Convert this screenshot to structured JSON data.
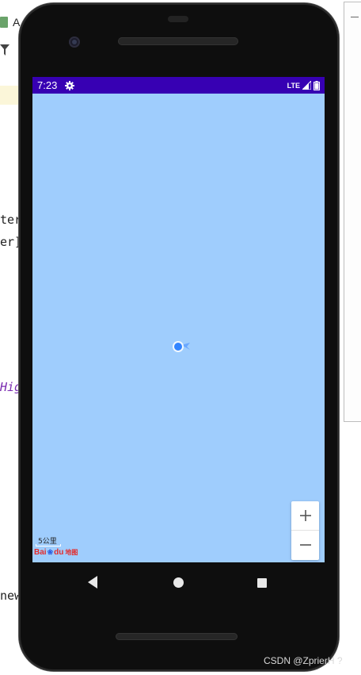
{
  "ide": {
    "tab_label": "A",
    "code_fragments": [
      "ter",
      "er]",
      "Hig",
      "new"
    ]
  },
  "status_bar": {
    "time": "7:23",
    "network": "LTE"
  },
  "map": {
    "scale_label": "5公里",
    "logo": {
      "bai": "Bai",
      "du": "du",
      "map": "地图"
    }
  },
  "zoom": {
    "in_label": "+",
    "out_label": "−"
  },
  "watermark": "CSDN @ZprierH ?",
  "colors": {
    "status_bar": "#3700b3",
    "map_water": "#9fcdfd",
    "marker": "#3385ff"
  }
}
